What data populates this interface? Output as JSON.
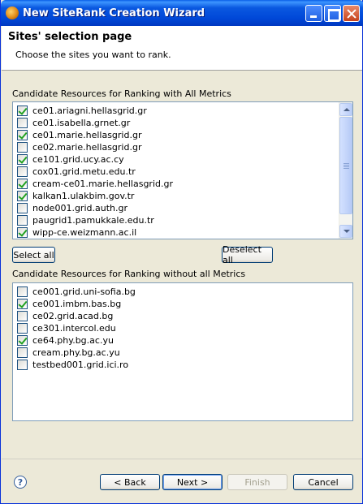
{
  "window": {
    "title": "New SiteRank Creation Wizard"
  },
  "header": {
    "title": "Sites' selection page",
    "description": "Choose the sites you want to rank."
  },
  "all_metrics": {
    "label": "Candidate Resources for Ranking with All Metrics",
    "items": [
      {
        "label": "ce01.ariagni.hellasgrid.gr",
        "checked": true
      },
      {
        "label": "ce01.isabella.grnet.gr",
        "checked": false
      },
      {
        "label": "ce01.marie.hellasgrid.gr",
        "checked": true
      },
      {
        "label": "ce02.marie.hellasgrid.gr",
        "checked": false
      },
      {
        "label": "ce101.grid.ucy.ac.cy",
        "checked": true
      },
      {
        "label": "cox01.grid.metu.edu.tr",
        "checked": false
      },
      {
        "label": "cream-ce01.marie.hellasgrid.gr",
        "checked": true
      },
      {
        "label": "kalkan1.ulakbim.gov.tr",
        "checked": true
      },
      {
        "label": "node001.grid.auth.gr",
        "checked": false
      },
      {
        "label": "paugrid1.pamukkale.edu.tr",
        "checked": false
      },
      {
        "label": "wipp-ce.weizmann.ac.il",
        "checked": true
      }
    ]
  },
  "buttons": {
    "select_all": "Select all",
    "deselect_all": "Deselect all",
    "back": "< Back",
    "next": "Next >",
    "finish": "Finish",
    "cancel": "Cancel"
  },
  "without_metrics": {
    "label": "Candidate Resources for Ranking without all  Metrics",
    "items": [
      {
        "label": "ce001.grid.uni-sofia.bg",
        "checked": false
      },
      {
        "label": "ce001.imbm.bas.bg",
        "checked": true
      },
      {
        "label": "ce02.grid.acad.bg",
        "checked": false
      },
      {
        "label": "ce301.intercol.edu",
        "checked": false
      },
      {
        "label": "ce64.phy.bg.ac.yu",
        "checked": true
      },
      {
        "label": "cream.phy.bg.ac.yu",
        "checked": false
      },
      {
        "label": "testbed001.grid.ici.ro",
        "checked": false
      }
    ]
  },
  "help": {
    "glyph": "?"
  },
  "colors": {
    "titlebar": "#0048d8",
    "list_border": "#7f9db9",
    "check": "#21a121"
  }
}
